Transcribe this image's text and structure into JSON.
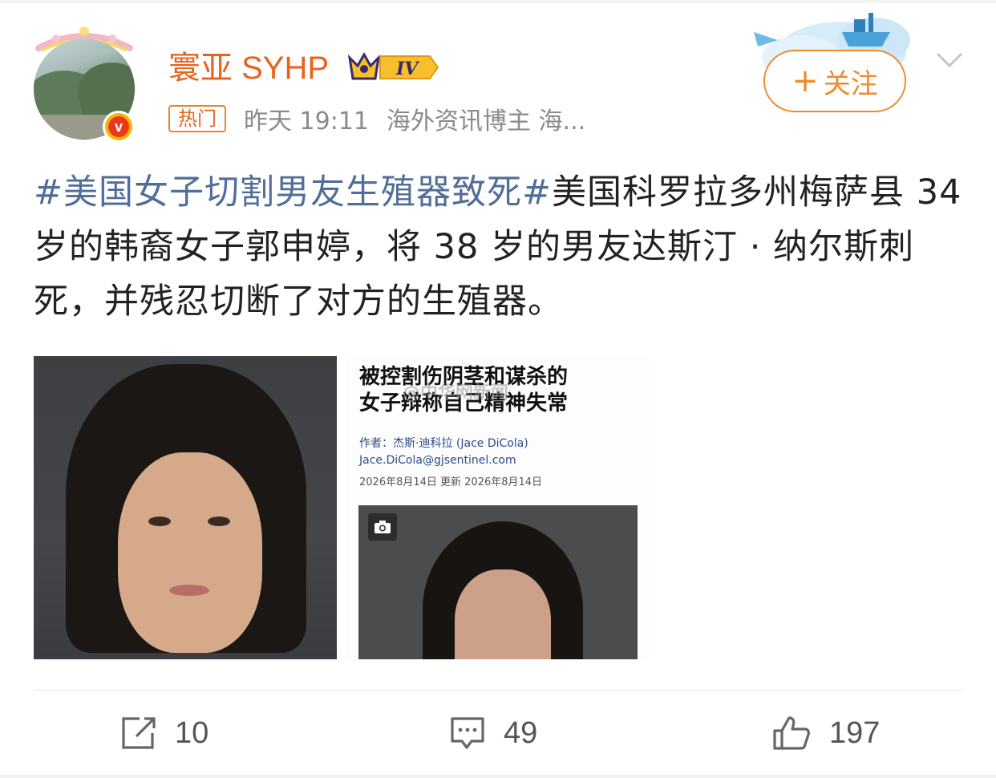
{
  "user": {
    "name": "寰亚 SYHP",
    "level_badge": "IV",
    "avatar_icon": "landscape-avatar",
    "verified_icon": "v-verified-badge"
  },
  "meta": {
    "hot_tag": "热门",
    "time": "昨天 19:11",
    "description": "海外资讯博主 海..."
  },
  "follow": {
    "plus": "+",
    "label": "关注"
  },
  "post": {
    "hashtag": "#美国女子切割男友生殖器致死#",
    "body": "美国科罗拉多州梅萨县 34 岁的韩裔女子郭申婷，将 38 岁的男友达斯汀 · 纳尔斯刺死，并残忍切断了对方的生殖器。"
  },
  "images": {
    "image2": {
      "title_line1": "被控割伤阴茎和谋杀的",
      "title_line2": "女子辩称自己精神失常",
      "watermark": "@中华网新闻",
      "author": "作者：杰斯·迪科拉 (Jace DiCola)",
      "email": "Jace.DiCola@gjsentinel.com",
      "date": "2026年8月14日 更新 2026年8月14日"
    }
  },
  "actions": {
    "share_count": "10",
    "comment_count": "49",
    "like_count": "197"
  },
  "colors": {
    "username": "#e8631c",
    "hashtag": "#506e9a",
    "follow": "#f08a2e"
  }
}
